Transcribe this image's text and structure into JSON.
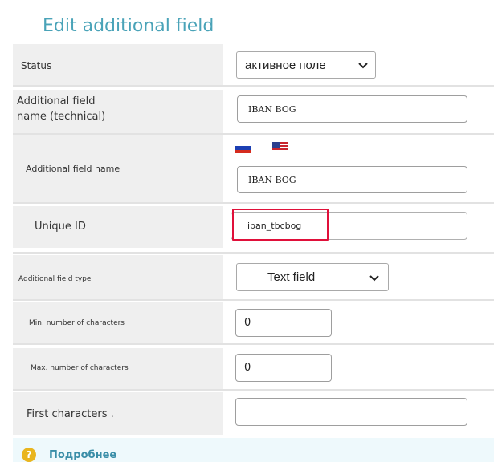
{
  "page": {
    "title": "Edit additional field"
  },
  "fields": {
    "status": {
      "label": "Status",
      "value": "активное поле"
    },
    "technical_name": {
      "label_line1": "Additional field",
      "label_line2": "name (technical)",
      "value": "IBAN BOG"
    },
    "display_name": {
      "label": "Additional field name",
      "value": "IBAN BOG",
      "languages": [
        "ru",
        "en"
      ]
    },
    "unique_id": {
      "label": "Unique ID",
      "value": "iban_tbcbog"
    },
    "field_type": {
      "label": "Additional field type",
      "value": "Text field"
    },
    "min_chars": {
      "label": "Min. number of characters",
      "value": "0"
    },
    "max_chars": {
      "label": "Max. number of characters",
      "value": "0"
    },
    "first_chars": {
      "label": "First characters .",
      "value": ""
    }
  },
  "more": {
    "label": "Подробнее"
  },
  "colors": {
    "title": "#4aa3b8",
    "label_bg": "#efefef",
    "highlight": "#e0103a",
    "help_icon": "#e9b51e"
  },
  "icons": [
    "chevron-down-icon",
    "flag-ru-icon",
    "flag-us-icon",
    "help-icon"
  ]
}
